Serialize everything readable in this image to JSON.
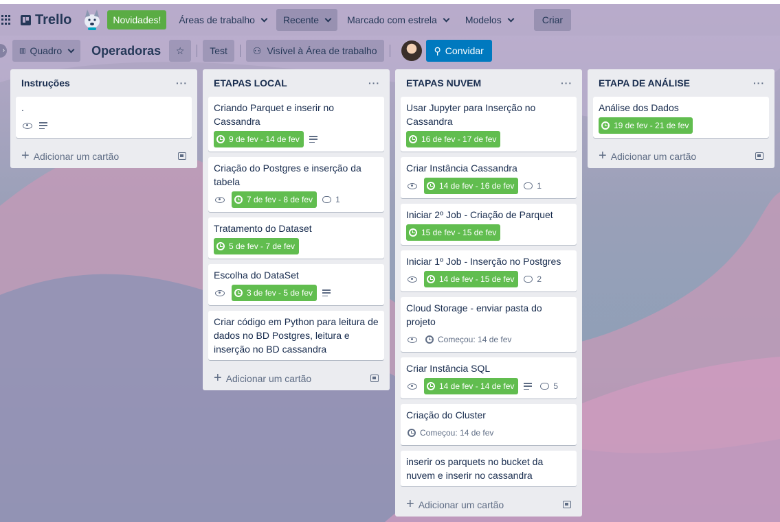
{
  "header": {
    "logo": "Trello",
    "news": "Novidades!",
    "nav": [
      {
        "label": "Áreas de trabalho"
      },
      {
        "label": "Recente"
      },
      {
        "label": "Marcado com estrela"
      },
      {
        "label": "Modelos"
      }
    ],
    "create": "Criar"
  },
  "board": {
    "view": "Quadro",
    "title": "Operadoras",
    "workspace": "Test",
    "visibility": "Visível à Área de trabalho",
    "invite": "Convidar"
  },
  "lists": [
    {
      "title": "Instruções",
      "menu": "···",
      "add": "Adicionar um cartão",
      "cards": [
        {
          "title": "."
        }
      ]
    },
    {
      "title": "ETAPAS LOCAL",
      "menu": "···",
      "add": "Adicionar um cartão",
      "cards": [
        {
          "title": "Criando Parquet e inserir no Cassandra",
          "date": "9 de fev - 14 de fev"
        },
        {
          "title": "Criação do Postgres e inserção da tabela",
          "date": "7 de fev - 8 de fev",
          "comments": "1"
        },
        {
          "title": "Tratamento do Dataset",
          "date": "5 de fev - 7 de fev"
        },
        {
          "title": "Escolha do DataSet",
          "date": "3 de fev - 5 de fev"
        },
        {
          "title": "Criar código em Python para leitura de dados no BD Postgres, leitura e inserção no BD cassandra"
        }
      ]
    },
    {
      "title": "ETAPAS NUVEM",
      "menu": "···",
      "add": "Adicionar um cartão",
      "cards": [
        {
          "title": "Usar Jupyter para Inserção no Cassandra",
          "date": "16 de fev - 17 de fev"
        },
        {
          "title": "Criar Instância Cassandra",
          "date": "14 de fev - 16 de fev",
          "comments": "1"
        },
        {
          "title": "Iniciar 2º Job - Criação de Parquet",
          "date": "15 de fev - 15 de fev"
        },
        {
          "title": "Iniciar 1º Job - Inserção no Postgres",
          "date": "14 de fev - 15 de fev",
          "comments": "2"
        },
        {
          "title": "Cloud Storage - enviar pasta do projeto",
          "date": "Começou: 14 de fev"
        },
        {
          "title": "Criar Instância SQL",
          "date": "14 de fev - 14 de fev",
          "comments": "5"
        },
        {
          "title": "Criação do Cluster",
          "date": "Começou: 14 de fev"
        },
        {
          "title": "inserir os parquets no bucket da nuvem e inserir no cassandra"
        }
      ]
    },
    {
      "title": "ETAPA DE ANÁLISE",
      "menu": "···",
      "add": "Adicionar um cartão",
      "cards": [
        {
          "title": "Análise dos Dados",
          "date": "19 de fev - 21 de fev"
        }
      ]
    }
  ],
  "colors": {
    "date_badge": "#61bd4f",
    "invite": "#0079bf",
    "news": "#5aac44"
  }
}
